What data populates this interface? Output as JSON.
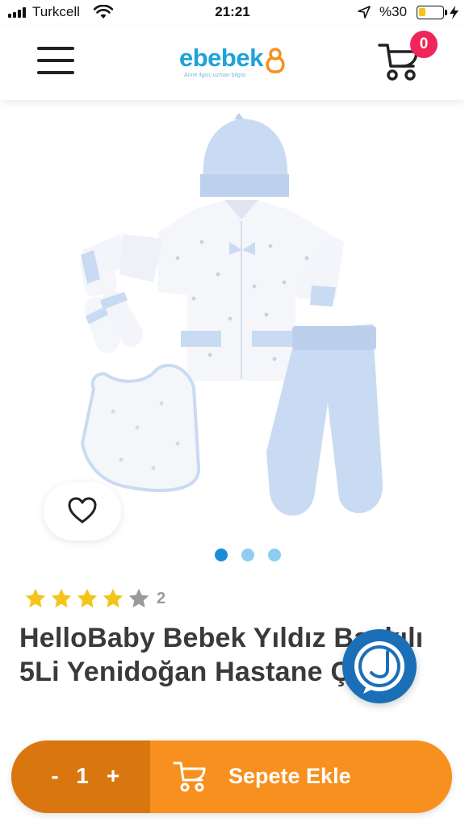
{
  "status_bar": {
    "carrier": "Turkcell",
    "time": "21:21",
    "battery_percent": "%30",
    "battery_level": 0.3
  },
  "header": {
    "logo_text": "ebebek",
    "logo_tagline": "Anne ilgisi, uzman bilgisi",
    "cart_count": "0",
    "brand_color": "#1da3d8",
    "badge_color": "#f0255a"
  },
  "gallery": {
    "dots": [
      {
        "active": true
      },
      {
        "active": false
      },
      {
        "active": false
      }
    ]
  },
  "product": {
    "rating": 4,
    "rating_max": 5,
    "rating_count": "2",
    "title_line1": "HelloBaby Bebek Yıldız Baskılı",
    "title_line2": "5Li Yenidoğan Hastane Çıkışı"
  },
  "cart_bar": {
    "minus": "-",
    "quantity": "1",
    "plus": "+",
    "add_label": "Sepete Ekle",
    "accent_color": "#f7901e",
    "qty_bg_color": "#d9760f"
  },
  "icons": {
    "menu": "hamburger-icon",
    "cart": "stroller-cart-icon",
    "favorite": "heart-outline-icon",
    "chat": "smile-chat-icon",
    "add_to_cart": "stroller-cart-icon"
  }
}
